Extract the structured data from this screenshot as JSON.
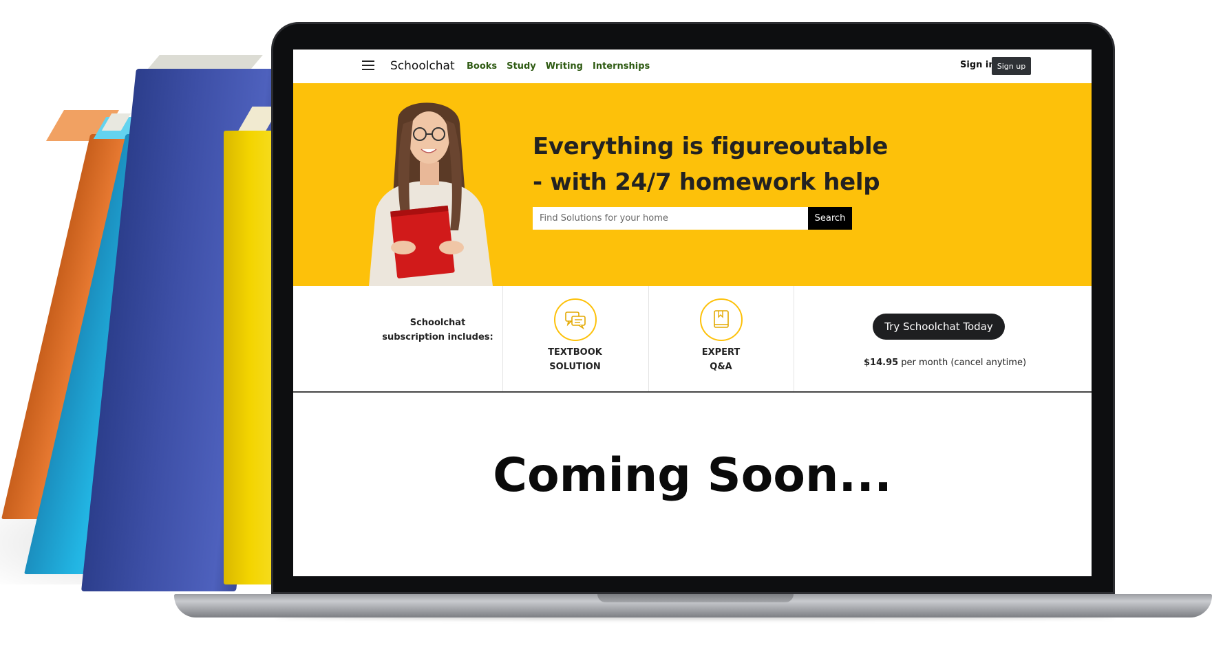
{
  "header": {
    "brand": "Schoolchat",
    "nav": [
      "Books",
      "Study",
      "Writing",
      "Internships"
    ],
    "sign_in": "Sign in",
    "sign_up": "Sign up"
  },
  "hero": {
    "title_line1": "Everything is figureoutable",
    "title_line2": "- with 24/7 homework help",
    "search_placeholder": "Find Solutions for your home",
    "search_button": "Search"
  },
  "features": {
    "intro_line1": "Schoolchat",
    "intro_line2": "subscription includes:",
    "items": [
      {
        "line1": "TEXTBOOK",
        "line2": "SOLUTION",
        "icon": "chat-bubbles-icon"
      },
      {
        "line1": "EXPERT",
        "line2": "Q&A",
        "icon": "book-icon"
      }
    ],
    "cta": "Try Schoolchat Today",
    "price": "$14.95",
    "price_suffix": " per month (cancel anytime)"
  },
  "main": {
    "coming_soon": "Coming Soon..."
  },
  "colors": {
    "hero_bg": "#fdc10a",
    "nav_link": "#2e5a12",
    "button_dark": "#1e1f21"
  }
}
